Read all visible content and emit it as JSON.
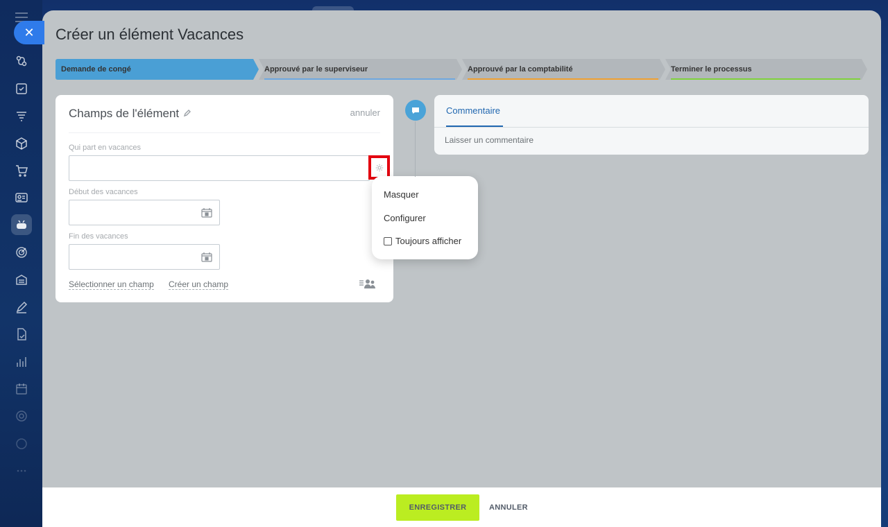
{
  "close_symbol": "✕",
  "page": {
    "title": "Créer un élément Vacances"
  },
  "stages": [
    {
      "label": "Demande de congé",
      "color": "#4a9fd5",
      "line_color": "#4a9fd5",
      "active": true
    },
    {
      "label": "Approuvé par le superviseur",
      "color": "#b2b7bb",
      "line_color": "#6ea7e0",
      "active": false
    },
    {
      "label": "Approuvé par la comptabilité",
      "color": "#b2b7bb",
      "line_color": "#f0a030",
      "active": false
    },
    {
      "label": "Terminer le processus",
      "color": "#b2b7bb",
      "line_color": "#7fd23b",
      "active": false
    }
  ],
  "card": {
    "title": "Champs de l'élément",
    "cancel": "annuler",
    "fields": [
      {
        "label": "Qui part en vacances",
        "value": ""
      },
      {
        "label": "Début des vacances",
        "value": ""
      },
      {
        "label": "Fin des vacances",
        "value": ""
      }
    ],
    "select_field": "Sélectionner un champ",
    "create_field": "Créer un champ"
  },
  "menu": {
    "hide": "Masquer",
    "configure": "Configurer",
    "always_show": "Toujours afficher",
    "always_show_checked": false
  },
  "comments": {
    "tab": "Commentaire",
    "placeholder": "Laisser un commentaire"
  },
  "footer": {
    "save": "ENREGISTRER",
    "cancel": "ANNULER"
  },
  "colors": {
    "accent": "#2f7bea",
    "save_button": "#bbed21",
    "highlight": "#e3000f",
    "timeline_dot": "#4aa3d8"
  }
}
